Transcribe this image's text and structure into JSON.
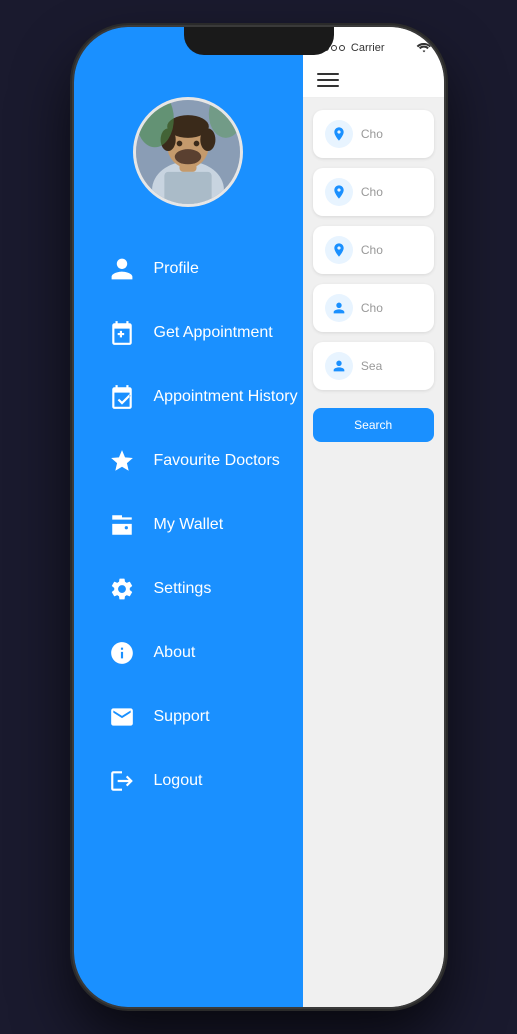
{
  "phone": {
    "status_bar": {
      "dots": [
        "filled",
        "filled",
        "empty",
        "empty"
      ],
      "carrier": "Carrier",
      "wifi": "wifi"
    }
  },
  "sidebar": {
    "menu_items": [
      {
        "id": "profile",
        "label": "Profile",
        "icon": "person"
      },
      {
        "id": "get-appointment",
        "label": "Get Appointment",
        "icon": "calendar"
      },
      {
        "id": "appointment-history",
        "label": "Appointment History",
        "icon": "calendar-check"
      },
      {
        "id": "favourite-doctors",
        "label": "Favourite Doctors",
        "icon": "star"
      },
      {
        "id": "my-wallet",
        "label": "My Wallet",
        "icon": "wallet"
      },
      {
        "id": "settings",
        "label": "Settings",
        "icon": "gear"
      },
      {
        "id": "about",
        "label": "About",
        "icon": "info"
      },
      {
        "id": "support",
        "label": "Support",
        "icon": "envelope"
      },
      {
        "id": "logout",
        "label": "Logout",
        "icon": "door"
      }
    ]
  },
  "right_panel": {
    "search_items": [
      {
        "label": "Cho",
        "icon": "pin-blue"
      },
      {
        "label": "Cho",
        "icon": "pin"
      },
      {
        "label": "Cho",
        "icon": "pin"
      },
      {
        "label": "Cho",
        "icon": "person-blue"
      },
      {
        "label": "Sea",
        "icon": "doctor"
      }
    ],
    "search_button_label": "Search"
  }
}
